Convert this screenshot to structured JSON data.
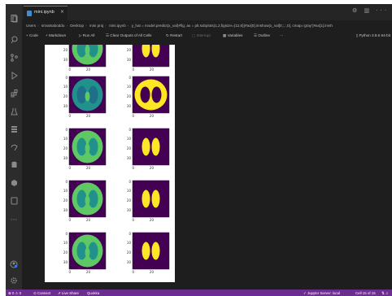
{
  "tab": {
    "label": "mini.ipynb",
    "close": "×"
  },
  "title_actions": "⚙ ▥ ···",
  "breadcrumb": {
    "items": [
      "Users",
      "srivatsaboddu",
      "Desktop",
      "mini proj",
      "mini.ipynb",
      "y_hat = model.predict(x_val)#fig, ax = plt.subplots(1,2,figsize=(12,6))#ax[0].imshow(x_val[0,:,:,0], cmap='gray')#ax[1].imsh"
    ],
    "separator": "›"
  },
  "toolbar": {
    "code": "+ Code",
    "markdown": "+ Markdown",
    "run_all": "▷ Run All",
    "clear_outputs": "☰ Clear Outputs of All Cells",
    "restart": "↻ Restart",
    "interrupt": "▢ Interrupt",
    "variables": "▦ Variables",
    "outline": "☰ Outline",
    "more": "···",
    "kernel": "Python 3.8.5 64-bit"
  },
  "figures": {
    "axis_ticks_left": [
      "20",
      "30"
    ],
    "axis_ticks_y": [
      "0",
      "10",
      "20",
      "30"
    ],
    "axis_ticks_x": [
      "0",
      "20"
    ],
    "cmap_colors": {
      "purple": "#440154",
      "teal": "#21918c",
      "green": "#5ec962",
      "yellow": "#fde725"
    },
    "rows": [
      {
        "left": "lungs-scan",
        "right": "mask"
      },
      {
        "left": "lungs-scan",
        "right": "mask"
      },
      {
        "left": "lungs-scan",
        "right": "mask"
      },
      {
        "left": "lungs-scan",
        "right": "mask"
      },
      {
        "left": "lungs-scan",
        "right": "mask"
      }
    ]
  },
  "statusbar": {
    "problems": "⊗ 0 ⚠ 0",
    "connect": "⊙ Connect",
    "live_share": "⇗ Live Share",
    "quokka": "Quokka",
    "jupyter": "✓ Jupyter Server: local",
    "cell": "Cell 15 of 15",
    "icons": "⇅ ♫"
  }
}
